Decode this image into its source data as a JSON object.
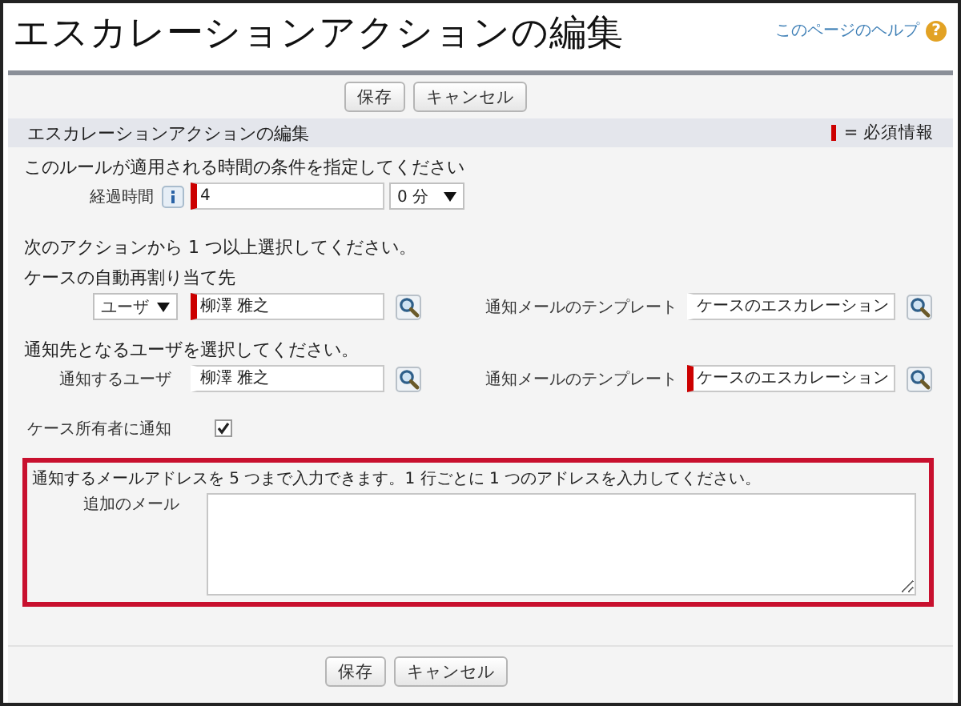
{
  "page": {
    "title": "エスカレーションアクションの編集",
    "help_link": "このページのヘルプ",
    "help_icon": "?"
  },
  "top_buttons": [
    "保存",
    "キャンセル"
  ],
  "section": {
    "title": "エスカレーションアクションの編集",
    "required_legend": "= 必須情報"
  },
  "time_condition": {
    "heading": "このルールが適用される時間の条件を指定してください",
    "label": "経過時間",
    "value": "4",
    "required": true,
    "unit": "0 分"
  },
  "actions_heading": "次のアクションから 1 つ以上選択してください。",
  "reassign": {
    "heading": "ケースの自動再割り当て先",
    "owner_type": "ユーザ",
    "owner": "柳澤 雅之",
    "owner_required": true,
    "template_label": "通知メールのテンプレート",
    "template": "ケースのエスカレーション",
    "template_required": false
  },
  "notify": {
    "heading": "通知先となるユーザを選択してください。",
    "user_label": "通知するユーザ",
    "user": "柳澤 雅之",
    "user_required": false,
    "template_label": "通知メールのテンプレート",
    "template": "ケースのエスカレーション",
    "template_required": true
  },
  "notify_owner": {
    "label": "ケース所有者に通知",
    "checked": true
  },
  "additional_emails": {
    "instruction": "通知するメールアドレスを 5 つまで入力できます。1 行ごとに 1 つのアドレスを入力してください。",
    "label": "追加のメール",
    "highlighted": true
  },
  "bottom_buttons": [
    "保存",
    "キャンセル"
  ]
}
